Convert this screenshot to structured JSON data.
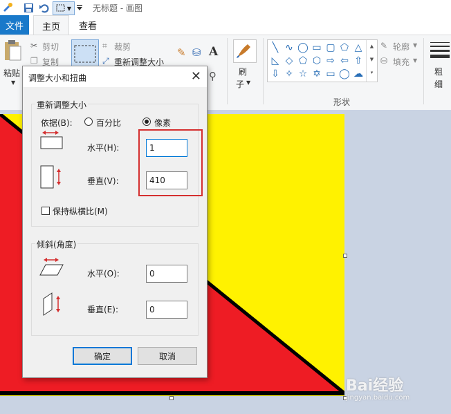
{
  "window": {
    "title": "无标题 - 画图"
  },
  "tabs": {
    "file": "文件",
    "home": "主页",
    "view": "查看"
  },
  "ribbon": {
    "paste": "粘贴",
    "cut": "剪切",
    "copy": "复制",
    "crop": "裁剪",
    "resize": "重新调整大小",
    "brush": "刷",
    "brush2": "子",
    "outline": "轮廓",
    "fill": "填充",
    "size": "粗",
    "size2": "细",
    "shapes_group": "形状"
  },
  "dialog": {
    "title": "调整大小和扭曲",
    "resize_group": "重新调整大小",
    "by_label": "依据(B):",
    "percent_label": "百分比",
    "pixels_label": "像素",
    "selected_unit": "pixels",
    "h_label": "水平(H):",
    "h_value": "1",
    "v_label": "垂直(V):",
    "v_value": "410",
    "keep_ratio_label": "保持纵横比(M)",
    "keep_ratio_checked": false,
    "skew_group": "倾斜(角度)",
    "skew_h_label": "水平(O):",
    "skew_h_value": "0",
    "skew_v_label": "垂直(E):",
    "skew_v_value": "0",
    "ok": "确定",
    "cancel": "取消"
  },
  "canvas": {
    "colors": {
      "red": "#ee1c24",
      "yellow": "#fff200",
      "line": "#000000"
    }
  },
  "watermark": {
    "text": "Bai经验",
    "url": "jingyan.baidu.com"
  }
}
